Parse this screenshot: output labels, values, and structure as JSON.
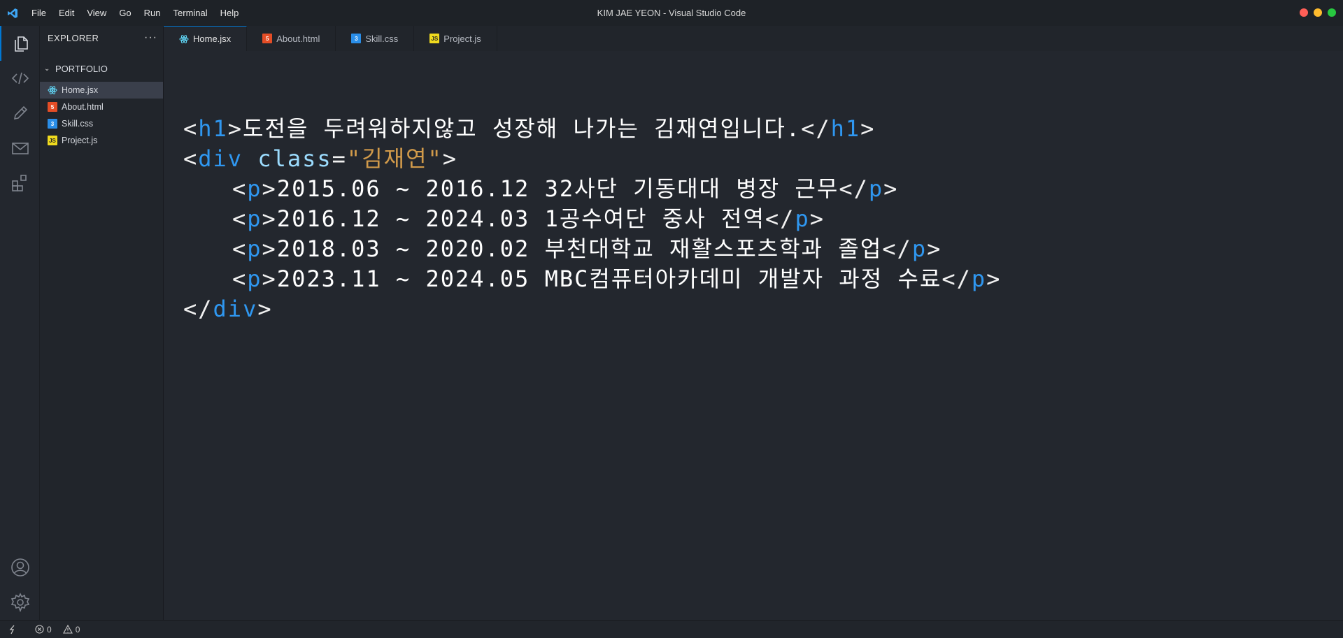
{
  "window": {
    "title": "KIM JAE YEON - Visual Studio Code",
    "traffic_colors": [
      "#ff5f57",
      "#febc2e",
      "#28c840"
    ]
  },
  "menu": [
    "File",
    "Edit",
    "View",
    "Go",
    "Run",
    "Terminal",
    "Help"
  ],
  "sidebar": {
    "title": "EXPLORER",
    "more": "···",
    "folder": "PORTFOLIO",
    "files": [
      {
        "name": "Home.jsx",
        "icon": "react-icon",
        "selected": true
      },
      {
        "name": "About.html",
        "icon": "html5-icon",
        "selected": false
      },
      {
        "name": "Skill.css",
        "icon": "css3-icon",
        "selected": false
      },
      {
        "name": "Project.js",
        "icon": "javascript-icon",
        "selected": false
      }
    ]
  },
  "tabs": [
    {
      "label": "Home.jsx",
      "icon": "react-icon",
      "active": true
    },
    {
      "label": "About.html",
      "icon": "html5-icon",
      "active": false
    },
    {
      "label": "Skill.css",
      "icon": "css3-icon",
      "active": false
    },
    {
      "label": "Project.js",
      "icon": "javascript-icon",
      "active": false
    }
  ],
  "code": {
    "h1_text": "도전을 두려워하지않고 성장해 나가는 김재연입니다.",
    "div_class_value": "김재연",
    "paragraphs": [
      "2015.06 ~ 2016.12 32사단 기동대대 병장 근무",
      "2016.12 ~ 2024.03 1공수여단 중사 전역",
      "2018.03 ~ 2020.02 부천대학교 재활스포츠학과 졸업",
      "2023.11 ~ 2024.05 MBC컴퓨터아카데미 개발자 과정 수료"
    ]
  },
  "status": {
    "errors": "0",
    "warnings": "0"
  },
  "colors": {
    "accent": "#0078d4",
    "tag": "#2f97f0",
    "string": "#d19a4a"
  }
}
